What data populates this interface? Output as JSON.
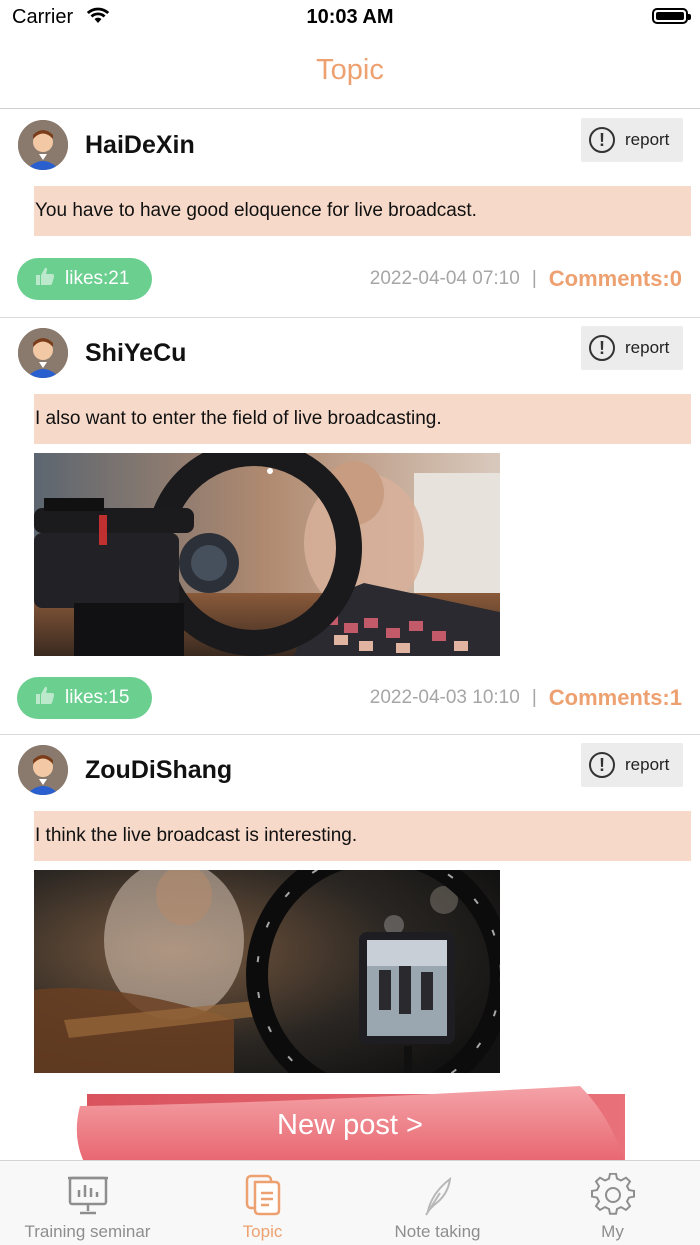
{
  "status_bar": {
    "carrier": "Carrier",
    "time": "10:03 AM"
  },
  "nav": {
    "title": "Topic"
  },
  "colors": {
    "accent": "#eea170",
    "likes_bg": "#6acf8f",
    "content_bg": "#f6d9c9",
    "button": "#f07c84"
  },
  "posts": [
    {
      "username": "HaiDeXin",
      "report_label": "report",
      "content": "You have to have good eloquence for live broadcast.",
      "likes": "likes:21",
      "date": "2022-04-04 07:10",
      "separator": "|",
      "comments": "Comments:0"
    },
    {
      "username": "ShiYeCu",
      "report_label": "report",
      "content": "I also want to enter the field of live broadcasting.",
      "likes": "likes:15",
      "date": "2022-04-03 10:10",
      "separator": "|",
      "comments": "Comments:1"
    },
    {
      "username": "ZouDiShang",
      "report_label": "report",
      "content": "I think the live broadcast is interesting."
    }
  ],
  "new_post_button": "New post >",
  "tabs": [
    {
      "label": "Training seminar",
      "icon": "presentation-board-icon"
    },
    {
      "label": "Topic",
      "icon": "document-icon",
      "active": true
    },
    {
      "label": "Note taking",
      "icon": "quill-icon"
    },
    {
      "label": "My",
      "icon": "gear-icon"
    }
  ]
}
